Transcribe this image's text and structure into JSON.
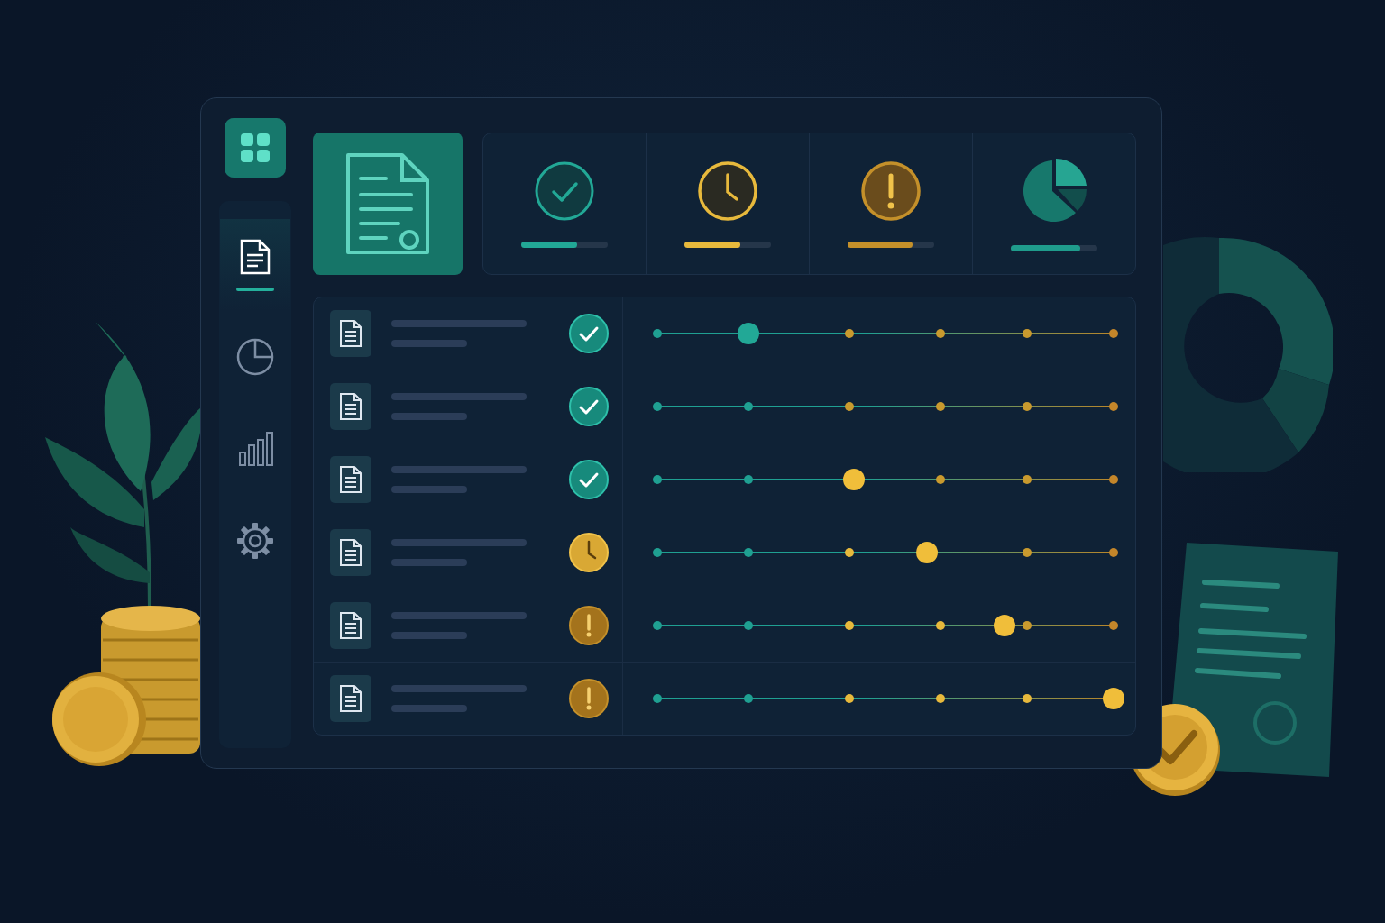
{
  "sidebar": {
    "items": [
      {
        "kind": "document",
        "selected": true
      },
      {
        "kind": "pie",
        "selected": false
      },
      {
        "kind": "bars",
        "selected": false
      },
      {
        "kind": "settings",
        "selected": false
      }
    ]
  },
  "summary": [
    {
      "kind": "check",
      "level": 0.65
    },
    {
      "kind": "clock",
      "level": 0.65
    },
    {
      "kind": "alert",
      "level": 0.75
    },
    {
      "kind": "pie",
      "level": 0.8
    }
  ],
  "rows": [
    {
      "kind": "check",
      "level": 0.2
    },
    {
      "kind": "check"
    },
    {
      "kind": "check",
      "level": 0.43
    },
    {
      "kind": "clock",
      "level": 0.59
    },
    {
      "kind": "alert",
      "level": 0.76
    },
    {
      "kind": "alert",
      "level": 1.0
    }
  ]
}
